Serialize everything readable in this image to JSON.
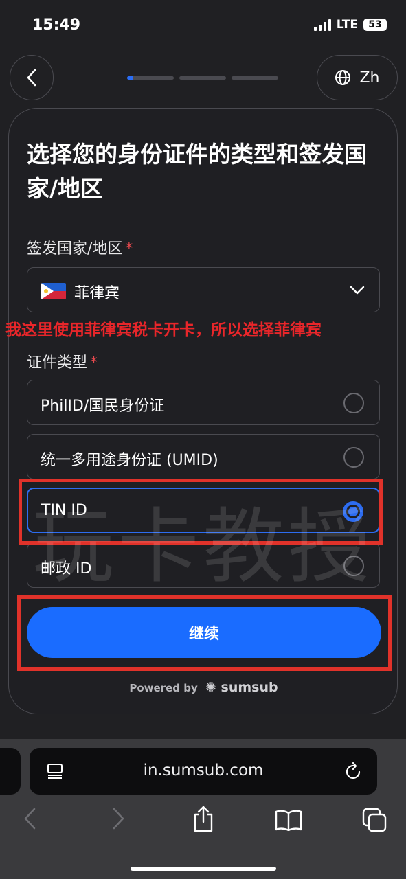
{
  "status_bar": {
    "time": "15:49",
    "network": "LTE",
    "battery": "53"
  },
  "header": {
    "language_label": "Zh"
  },
  "form": {
    "title": "选择您的身份证件的类型和签发国家/地区",
    "country_label": "签发国家/地区",
    "country_value": "菲律宾",
    "doc_type_label": "证件类型",
    "required_mark": "*",
    "options": [
      {
        "label": "PhilID/国民身份证",
        "selected": false
      },
      {
        "label": "统一多用途身份证 (UMID)",
        "selected": false
      },
      {
        "label": "TIN ID",
        "selected": true
      },
      {
        "label": "邮政 ID",
        "selected": false
      }
    ],
    "continue_label": "继续",
    "powered_by": "Powered by",
    "brand": "sumsub"
  },
  "annotation": "我这里使用菲律宾税卡开卡，所以选择菲律宾",
  "watermark": "玩卡教授",
  "browser": {
    "url": "in.sumsub.com"
  },
  "colors": {
    "accent": "#1a6cff",
    "annotation_red": "#e0322a",
    "background": "#202023"
  }
}
